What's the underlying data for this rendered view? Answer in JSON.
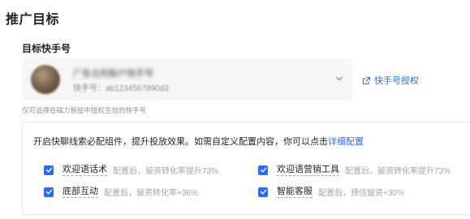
{
  "section": {
    "title": "推广目标"
  },
  "target": {
    "label": "目标快手号",
    "account_name": "广告主的账户快手号",
    "account_id": "快手号：ab1234567890d3",
    "authorize_label": "快手号授权",
    "hint": "仅可选择在磁力智投中授权生效的快手号"
  },
  "components": {
    "desc_prefix": "开启快聊线索必配组件，提升投放效果。如需自定义配置内容，你可以点击",
    "desc_link": "详细配置",
    "options": [
      {
        "label": "欢迎语话术",
        "note": "配置后，留资转化率提升73%",
        "checked": true
      },
      {
        "label": "欢迎语营销工具",
        "note": "配置后，留资转化率提升73%",
        "checked": true
      },
      {
        "label": "底部互动",
        "note": "配置后，留资转化率+36%",
        "checked": true
      },
      {
        "label": "智能客服",
        "note": "配置后，预估留资+30%",
        "checked": true
      }
    ]
  },
  "colors": {
    "accent": "#2b6cf6",
    "muted_text": "#a0a4ab",
    "field_bg": "#f5f6f7"
  },
  "icons": [
    "chevron-down-icon",
    "external-link-icon",
    "checkbox-checked-icon"
  ]
}
